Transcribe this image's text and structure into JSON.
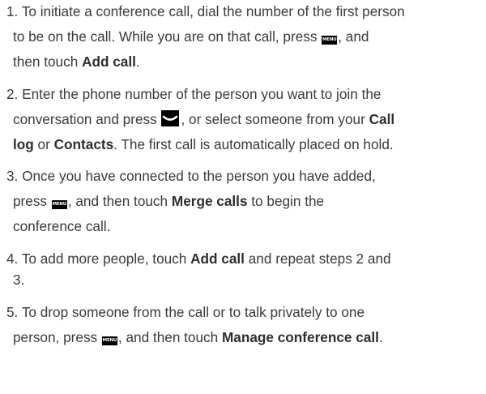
{
  "steps": [
    {
      "number": "1.",
      "lines": {
        "l1": "To initiate a conference call, dial the number of the first person",
        "l2a": "to be on the call. While you are on that call, press ",
        "l2b": ", and",
        "l3a": "then touch ",
        "l3b": "Add call",
        "l3c": "."
      }
    },
    {
      "number": "2.",
      "lines": {
        "l1": "Enter the phone number of the person you want to join the",
        "l2a": "conversation and press ",
        "l2b": ", or select someone from your ",
        "l2c": "Call",
        "l3a": "log",
        "l3b": " or ",
        "l3c": "Contacts",
        "l3d": ". The first call is automatically placed on hold."
      }
    },
    {
      "number": "3.",
      "lines": {
        "l1": "Once you have connected to the person you have added,",
        "l2a": "press ",
        "l2b": ", and then touch ",
        "l2c": "Merge calls",
        "l2d": " to begin the",
        "l3": "conference call."
      }
    },
    {
      "number": "4.",
      "lines": {
        "l1a": "To add more people, touch ",
        "l1b": "Add call",
        "l1c": " and repeat steps 2 and",
        "l2": "3."
      }
    },
    {
      "number": "5.",
      "lines": {
        "l1": "To drop someone from the call or to talk privately to one",
        "l2a": "person, press ",
        "l2b": ", and then touch ",
        "l2c": "Manage conference call",
        "l2d": "."
      }
    }
  ],
  "keys": {
    "menu_label": "MENU",
    "menu_icon": "menu-key-icon",
    "send_icon": "send-key-icon"
  }
}
